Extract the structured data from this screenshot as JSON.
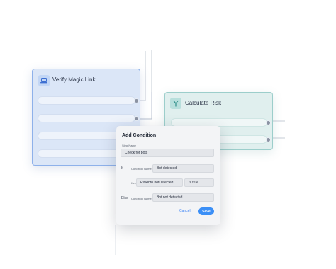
{
  "nodes": {
    "verify": {
      "title": "Verify Magic Link",
      "icon": "laptop-icon"
    },
    "risk": {
      "title": "Calculate Risk",
      "icon": "branch-icon"
    }
  },
  "dialog": {
    "title": "Add Condition",
    "step_name_label": "Step Name",
    "step_name_value": "Check for bots",
    "if_keyword": "If",
    "condition_name_label": "Condition Name",
    "condition_name_value": "Bot detected",
    "key_label": "Key",
    "key_value": "RiskInfo.botDetected",
    "operator_value": "Is true",
    "else_keyword": "Else",
    "else_condition_label": "Condition Name",
    "else_condition_value": "Bot not detected",
    "cancel_label": "Cancel",
    "save_label": "Save"
  },
  "colors": {
    "accent": "#3b8ff6",
    "verify_border": "#8eb1ea",
    "risk_border": "#9ccecb"
  }
}
